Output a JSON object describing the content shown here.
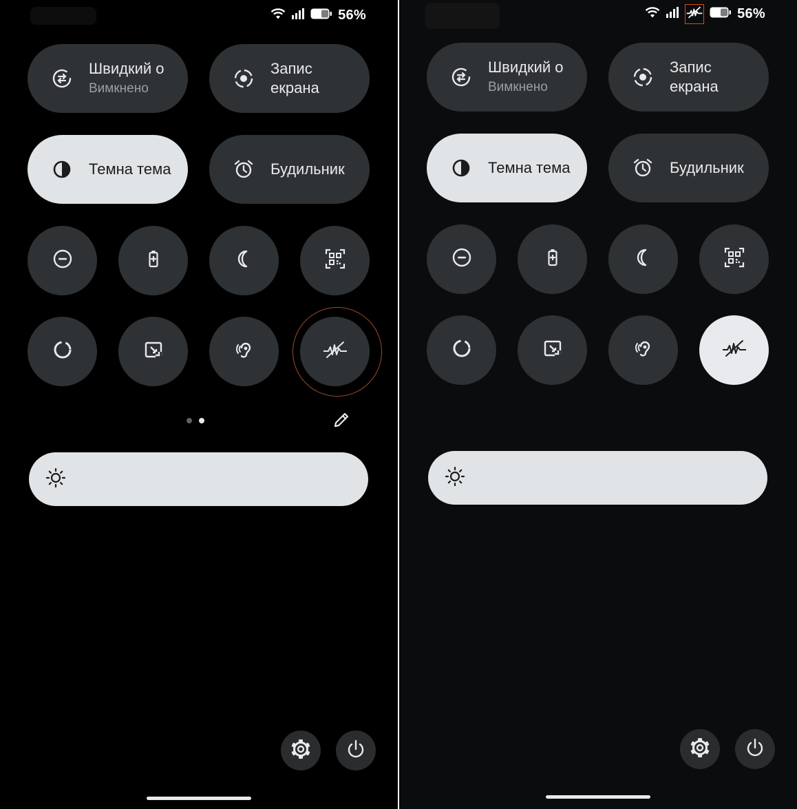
{
  "status_bar": {
    "battery_percent": "56%",
    "wifi_icon": "wifi-icon",
    "signal_icon": "cellular-signal-icon",
    "battery_icon": "battery-icon",
    "extra_icon_right": "sound-wave-off-icon"
  },
  "tiles": {
    "quick_share": {
      "title": "Швидкий о",
      "subtitle": "Вимкнено",
      "icon": "quick-share-icon"
    },
    "screen_record": {
      "title_line1": "Запис",
      "title_line2": "екрана",
      "icon": "screen-record-icon"
    },
    "dark_theme": {
      "title": "Темна тема",
      "icon": "dark-theme-icon",
      "state": "on"
    },
    "alarm": {
      "title": "Будильник",
      "icon": "alarm-clock-icon"
    },
    "small_tiles": [
      {
        "icon": "do-not-disturb-icon"
      },
      {
        "icon": "battery-saver-icon"
      },
      {
        "icon": "night-mode-icon"
      },
      {
        "icon": "qr-scanner-icon"
      },
      {
        "icon": "data-saver-icon"
      },
      {
        "icon": "screenshot-icon"
      },
      {
        "icon": "hearing-aid-icon"
      },
      {
        "icon": "sound-wave-off-icon"
      }
    ]
  },
  "pager": {
    "pages": 2,
    "active_page": 2
  },
  "brightness": {
    "icon": "brightness-icon",
    "level": 1.0
  },
  "bottom_buttons": {
    "settings": "gear-icon",
    "power": "power-icon"
  },
  "colors": {
    "tile_bg": "#2f3234",
    "tile_on_bg": "#e1e4e6",
    "highlight_ring": "#a04a2e",
    "highlight_box": "#e0471d"
  }
}
